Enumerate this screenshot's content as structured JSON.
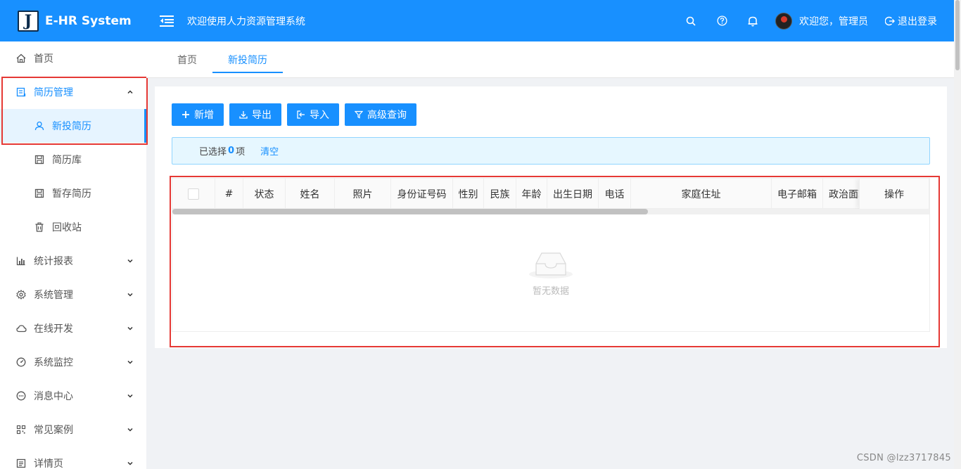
{
  "header": {
    "logo_letter": "J",
    "app_title": "E-HR System",
    "welcome_text": "欢迎使用人力资源管理系统",
    "user_greeting": "欢迎您，管理员",
    "logout_label": "退出登录",
    "icons": [
      "search-icon",
      "help-icon",
      "bell-icon"
    ]
  },
  "sidebar": {
    "items": [
      {
        "label": "首页",
        "icon": "home-icon"
      },
      {
        "label": "简历管理",
        "icon": "resume-icon"
      },
      {
        "label": "新投简历",
        "icon": "user-icon"
      },
      {
        "label": "简历库",
        "icon": "save-icon"
      },
      {
        "label": "暂存简历",
        "icon": "save-icon"
      },
      {
        "label": "回收站",
        "icon": "trash-icon"
      },
      {
        "label": "统计报表",
        "icon": "chart-icon"
      },
      {
        "label": "系统管理",
        "icon": "gear-icon"
      },
      {
        "label": "在线开发",
        "icon": "cloud-icon"
      },
      {
        "label": "系统监控",
        "icon": "dashboard-icon"
      },
      {
        "label": "消息中心",
        "icon": "message-icon"
      },
      {
        "label": "常见案例",
        "icon": "qrcode-icon"
      },
      {
        "label": "详情页",
        "icon": "profile-icon"
      }
    ]
  },
  "tabs": [
    {
      "label": "首页"
    },
    {
      "label": "新投简历"
    }
  ],
  "toolbar": {
    "add_label": "新增",
    "export_label": "导出",
    "import_label": "导入",
    "advanced_query_label": "高级查询"
  },
  "selection": {
    "prefix": "已选择",
    "count": "0",
    "suffix": "项",
    "clear_label": "清空"
  },
  "table": {
    "columns": [
      "#",
      "状态",
      "姓名",
      "照片",
      "身份证号码",
      "性别",
      "民族",
      "年龄",
      "出生日期",
      "电话",
      "家庭住址",
      "电子邮箱",
      "政治面貌",
      "操作"
    ],
    "empty_text": "暂无数据"
  },
  "watermark": "CSDN @lzz3717845",
  "colors": {
    "primary": "#1890ff",
    "highlight_box": "#e53935"
  }
}
